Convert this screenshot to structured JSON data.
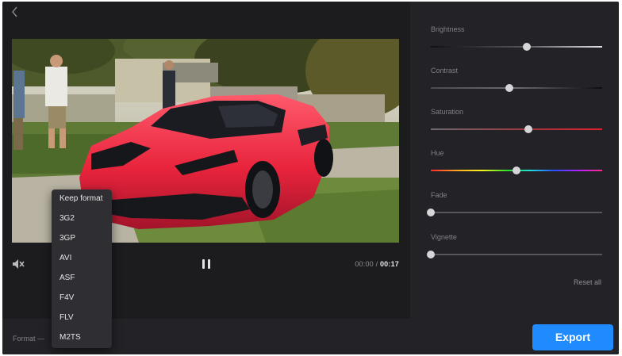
{
  "window": {
    "back_icon": "chevron-left-icon"
  },
  "player": {
    "mute_icon": "speaker-muted-icon",
    "pause_icon": "pause-icon",
    "current_time": "00:00",
    "separator": "/",
    "total_time": "00:17"
  },
  "adjustments": {
    "brightness": {
      "label": "Brightness",
      "value": 0.56
    },
    "contrast": {
      "label": "Contrast",
      "value": 0.46
    },
    "saturation": {
      "label": "Saturation",
      "value": 0.57
    },
    "hue": {
      "label": "Hue",
      "value": 0.5
    },
    "fade": {
      "label": "Fade",
      "value": 0.0
    },
    "vignette": {
      "label": "Vignette",
      "value": 0.0
    },
    "reset_label": "Reset all"
  },
  "footer": {
    "format_label": "Format —",
    "export_label": "Export",
    "accent_color": "#1f8bff"
  },
  "format_menu": {
    "options": [
      "Keep format",
      "3G2",
      "3GP",
      "AVI",
      "ASF",
      "F4V",
      "FLV",
      "M2TS"
    ]
  }
}
